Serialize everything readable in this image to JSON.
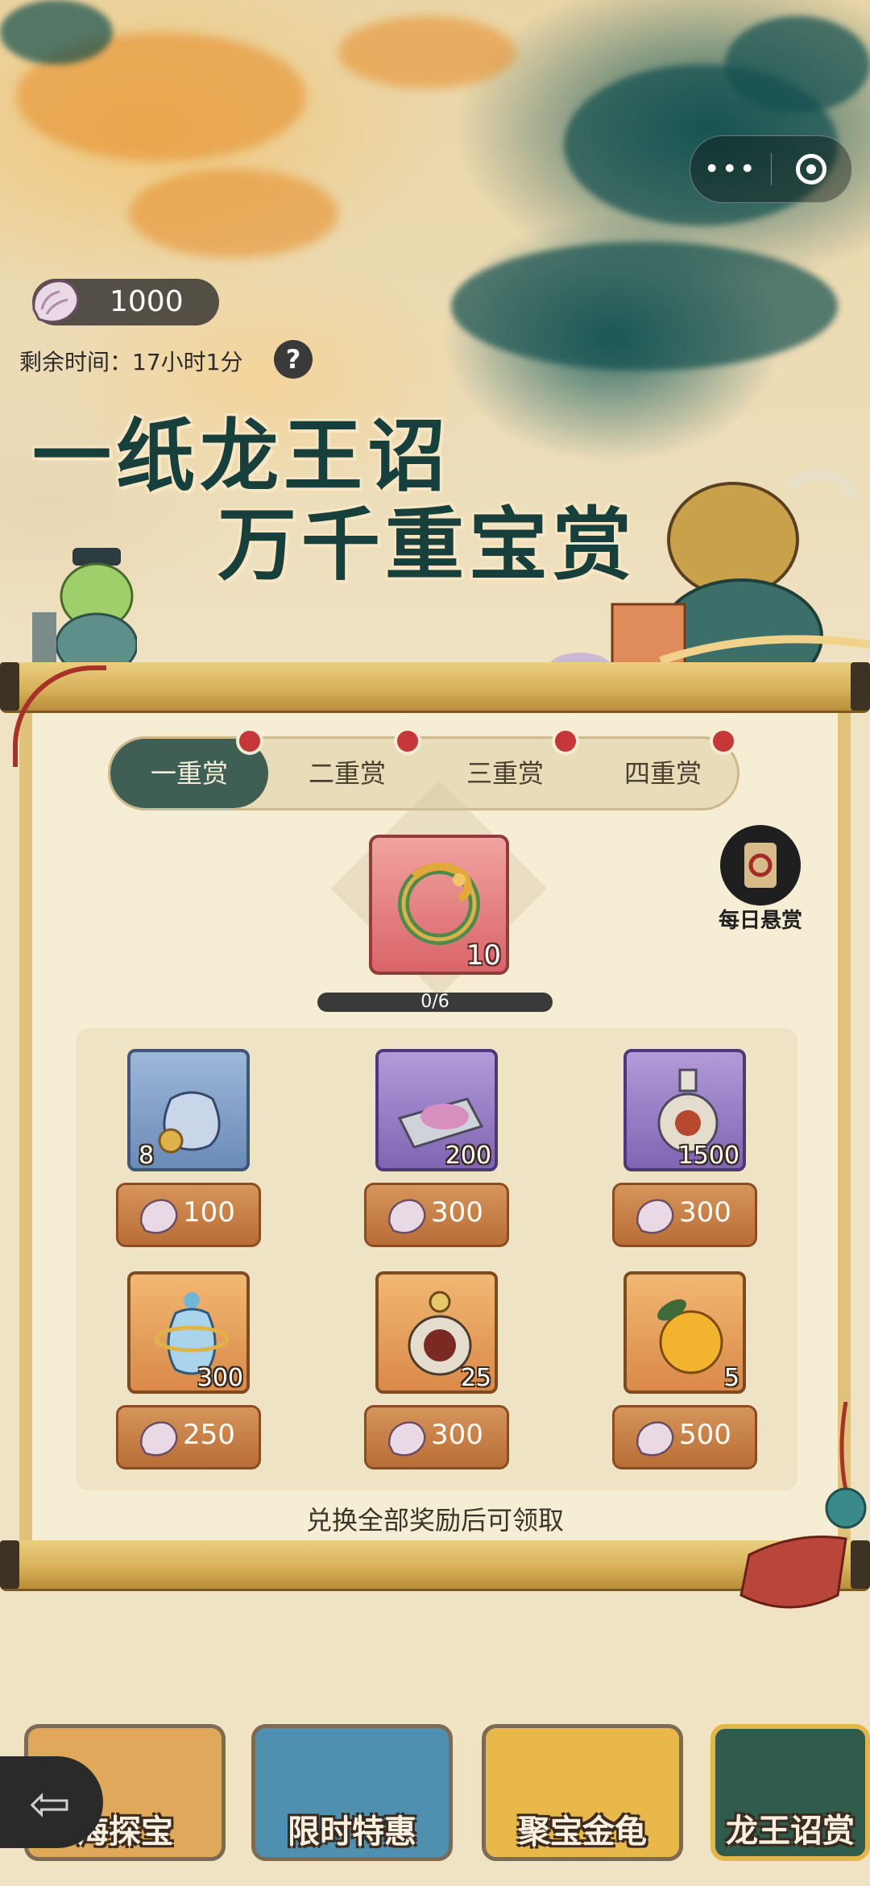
{
  "header": {
    "more_label": "•••",
    "currency": {
      "icon": "conch-shell-icon",
      "value": "1000"
    },
    "timer_text": "剩余时间：17小时1分",
    "help_label": "?",
    "headline_line1": "一纸龙王诏",
    "headline_line2": "万千重宝赏"
  },
  "tabs": [
    {
      "label": "一重赏",
      "active": true,
      "has_dot": true
    },
    {
      "label": "二重赏",
      "active": false,
      "has_dot": true
    },
    {
      "label": "三重赏",
      "active": false,
      "has_dot": true
    },
    {
      "label": "四重赏",
      "active": false,
      "has_dot": true
    }
  ],
  "featured": {
    "icon": "jade-dragon-icon",
    "quantity": "10"
  },
  "daily_bounty": {
    "label": "每日悬赏",
    "icon": "scroll-icon"
  },
  "progress": {
    "text": "0/6",
    "fraction": 0
  },
  "items": [
    {
      "icon": "coin-pouch-icon",
      "quantity": "8",
      "rarity": "blue",
      "price": "100"
    },
    {
      "icon": "purple-powder-icon",
      "quantity": "200",
      "rarity": "purple",
      "price": "300"
    },
    {
      "icon": "potion-bottle-icon",
      "quantity": "1500",
      "rarity": "purple",
      "price": "300"
    },
    {
      "icon": "blue-vase-icon",
      "quantity": "300",
      "rarity": "orange",
      "price": "250"
    },
    {
      "icon": "demon-gourd-icon",
      "quantity": "25",
      "rarity": "orange",
      "price": "300"
    },
    {
      "icon": "orange-fruit-icon",
      "quantity": "5",
      "rarity": "orange",
      "price": "500"
    }
  ],
  "footer_note": "兑换全部奖励后可领取",
  "carousel": [
    {
      "label": "海探宝",
      "active": false
    },
    {
      "label": "限时特惠",
      "active": false
    },
    {
      "label": "聚宝金龟",
      "active": false
    },
    {
      "label": "龙王诏赏",
      "active": true
    }
  ],
  "back_label": "⇦",
  "colors": {
    "accent_tab": "#3f5f55",
    "red_dot": "#c7373a",
    "price_button": "#c07a40"
  }
}
